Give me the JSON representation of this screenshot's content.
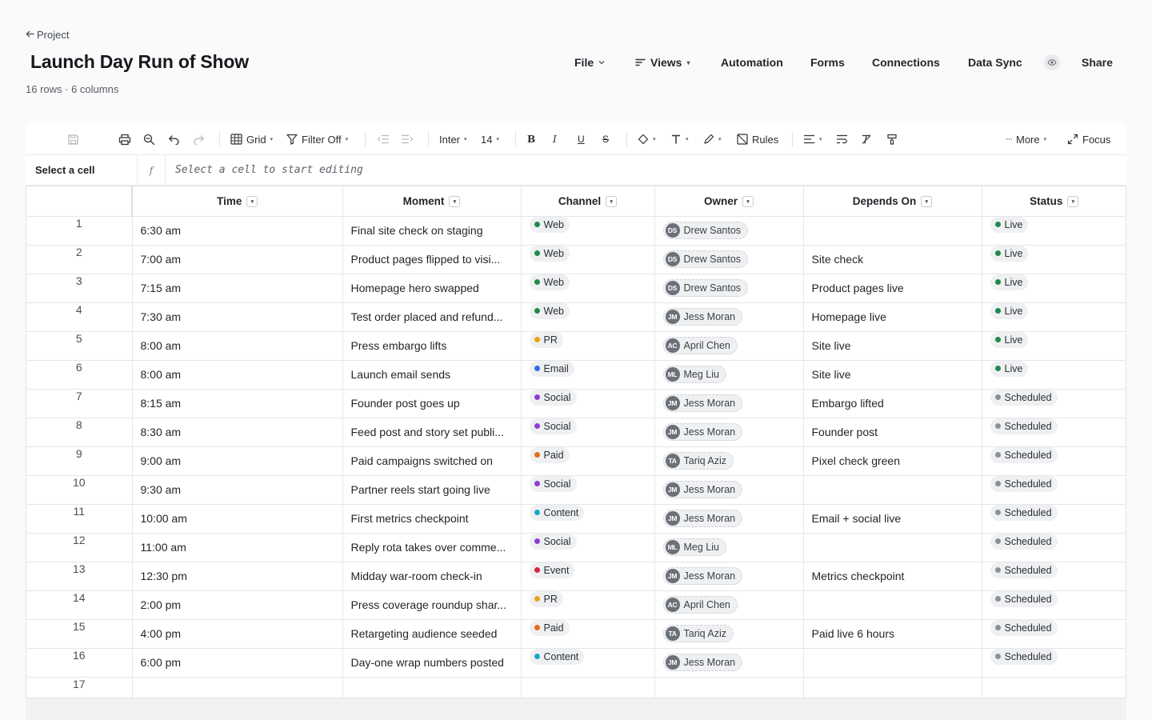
{
  "header": {
    "back_label": "Project",
    "title": "Launch Day Run of Show",
    "meta": "16 rows · 6 columns"
  },
  "nav": {
    "file": "File",
    "views": "Views",
    "automation": "Automation",
    "forms": "Forms",
    "connections": "Connections",
    "data_sync": "Data Sync",
    "share": "Share"
  },
  "toolbar": {
    "view": "Grid",
    "filter": "Filter Off",
    "font": "Inter",
    "font_size": "14",
    "rules": "Rules",
    "more": "More",
    "focus": "Focus"
  },
  "formula": {
    "cell_ref": "Select a cell",
    "fx": "f",
    "placeholder": "Select a cell to start editing"
  },
  "columns": [
    "Time",
    "Moment",
    "Channel",
    "Owner",
    "Depends On",
    "Status"
  ],
  "channel_colors": {
    "Web": "#1f8a4c",
    "PR": "#e8a317",
    "Email": "#2f6fe0",
    "Social": "#8e3fd6",
    "Paid": "#e66b1f",
    "Content": "#1aa7c7",
    "Event": "#d6283a"
  },
  "status_colors": {
    "Live": "#1f8a4c",
    "Scheduled": "#8d9197"
  },
  "rows": [
    {
      "n": "1",
      "time": "6:30 am",
      "moment": "Final site check on staging",
      "channel": "Web",
      "owner_initials": "DS",
      "owner": "Drew Santos",
      "depends": "",
      "status": "Live"
    },
    {
      "n": "2",
      "time": "7:00 am",
      "moment": "Product pages flipped to visi...",
      "channel": "Web",
      "owner_initials": "DS",
      "owner": "Drew Santos",
      "depends": "Site check",
      "status": "Live"
    },
    {
      "n": "3",
      "time": "7:15 am",
      "moment": "Homepage hero swapped",
      "channel": "Web",
      "owner_initials": "DS",
      "owner": "Drew Santos",
      "depends": "Product pages live",
      "status": "Live"
    },
    {
      "n": "4",
      "time": "7:30 am",
      "moment": "Test order placed and refund...",
      "channel": "Web",
      "owner_initials": "JM",
      "owner": "Jess Moran",
      "depends": "Homepage live",
      "status": "Live"
    },
    {
      "n": "5",
      "time": "8:00 am",
      "moment": "Press embargo lifts",
      "channel": "PR",
      "owner_initials": "AC",
      "owner": "April Chen",
      "depends": "Site live",
      "status": "Live"
    },
    {
      "n": "6",
      "time": "8:00 am",
      "moment": "Launch email sends",
      "channel": "Email",
      "owner_initials": "ML",
      "owner": "Meg Liu",
      "depends": "Site live",
      "status": "Live"
    },
    {
      "n": "7",
      "time": "8:15 am",
      "moment": "Founder post goes up",
      "channel": "Social",
      "owner_initials": "JM",
      "owner": "Jess Moran",
      "depends": "Embargo lifted",
      "status": "Scheduled"
    },
    {
      "n": "8",
      "time": "8:30 am",
      "moment": "Feed post and story set publi...",
      "channel": "Social",
      "owner_initials": "JM",
      "owner": "Jess Moran",
      "depends": "Founder post",
      "status": "Scheduled"
    },
    {
      "n": "9",
      "time": "9:00 am",
      "moment": "Paid campaigns switched on",
      "channel": "Paid",
      "owner_initials": "TA",
      "owner": "Tariq Aziz",
      "depends": "Pixel check green",
      "status": "Scheduled"
    },
    {
      "n": "10",
      "time": "9:30 am",
      "moment": "Partner reels start going live",
      "channel": "Social",
      "owner_initials": "JM",
      "owner": "Jess Moran",
      "depends": "",
      "status": "Scheduled"
    },
    {
      "n": "11",
      "time": "10:00 am",
      "moment": "First metrics checkpoint",
      "channel": "Content",
      "owner_initials": "JM",
      "owner": "Jess Moran",
      "depends": "Email + social live",
      "status": "Scheduled"
    },
    {
      "n": "12",
      "time": "11:00 am",
      "moment": "Reply rota takes over comme...",
      "channel": "Social",
      "owner_initials": "ML",
      "owner": "Meg Liu",
      "depends": "",
      "status": "Scheduled"
    },
    {
      "n": "13",
      "time": "12:30 pm",
      "moment": "Midday war-room check-in",
      "channel": "Event",
      "owner_initials": "JM",
      "owner": "Jess Moran",
      "depends": "Metrics checkpoint",
      "status": "Scheduled"
    },
    {
      "n": "14",
      "time": "2:00 pm",
      "moment": "Press coverage roundup shar...",
      "channel": "PR",
      "owner_initials": "AC",
      "owner": "April Chen",
      "depends": "",
      "status": "Scheduled"
    },
    {
      "n": "15",
      "time": "4:00 pm",
      "moment": "Retargeting audience seeded",
      "channel": "Paid",
      "owner_initials": "TA",
      "owner": "Tariq Aziz",
      "depends": "Paid live 6 hours",
      "status": "Scheduled"
    },
    {
      "n": "16",
      "time": "6:00 pm",
      "moment": "Day-one wrap numbers posted",
      "channel": "Content",
      "owner_initials": "JM",
      "owner": "Jess Moran",
      "depends": "",
      "status": "Scheduled"
    }
  ],
  "empty_row_number": "17"
}
